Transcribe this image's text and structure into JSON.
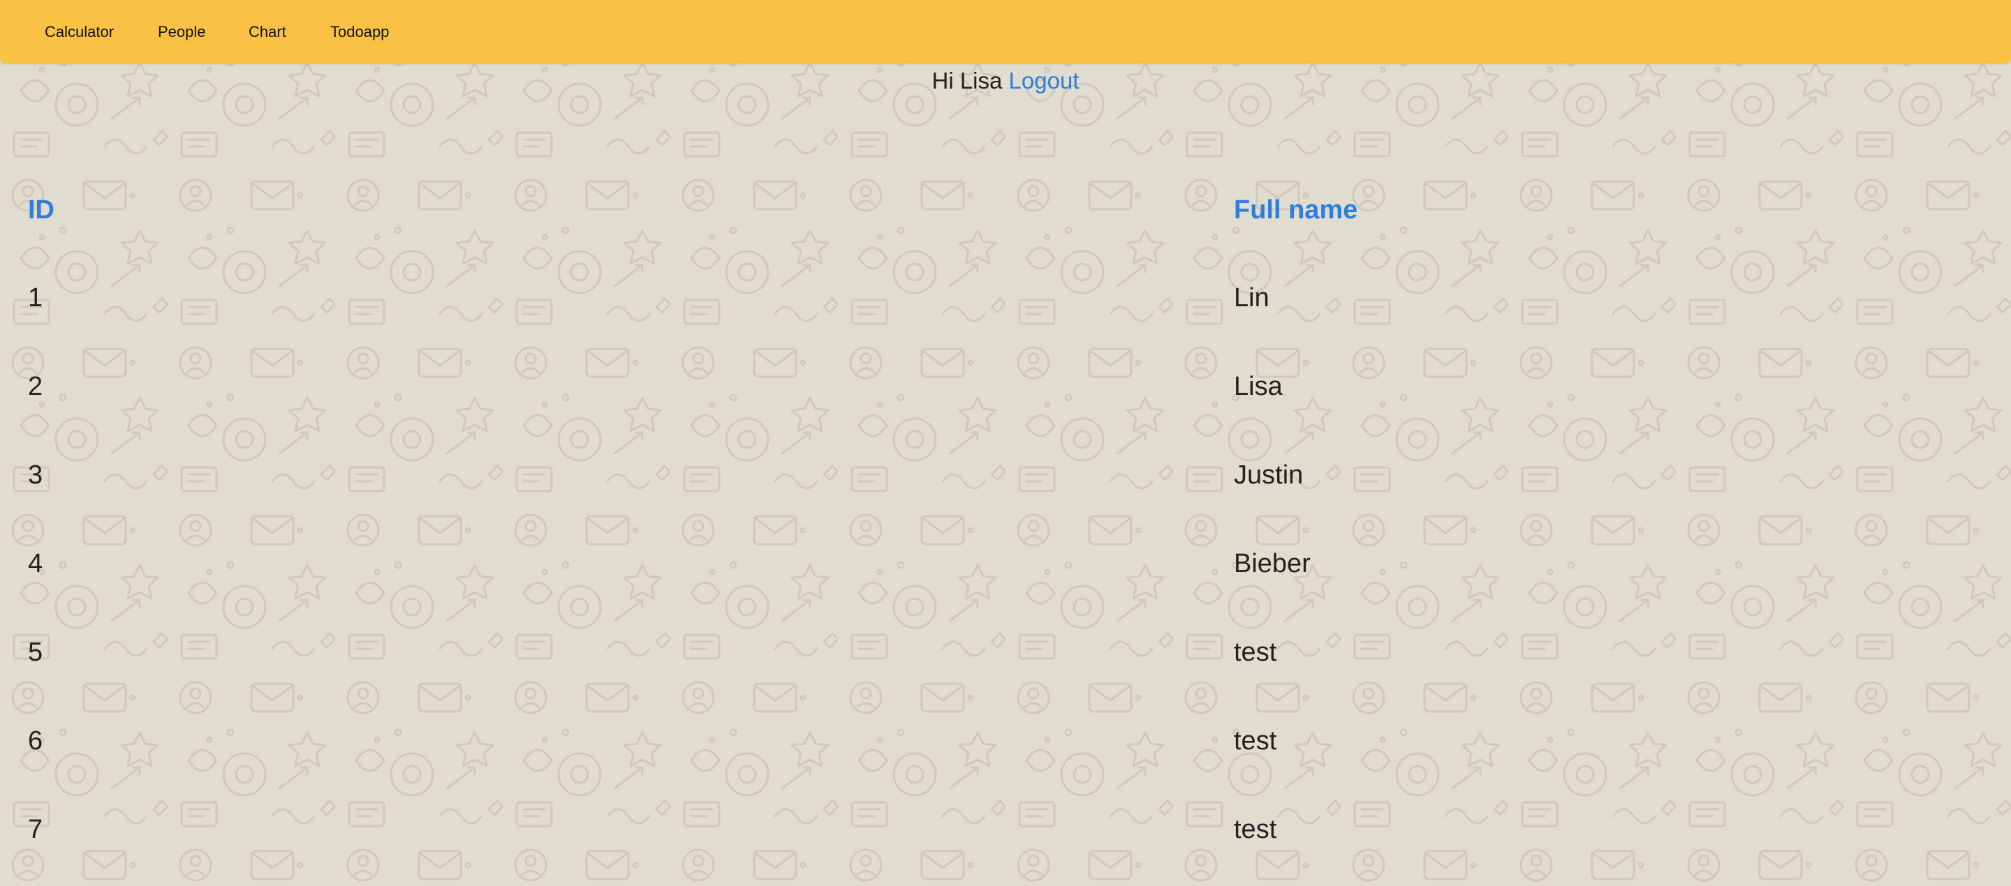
{
  "nav": {
    "items": [
      {
        "label": "Calculator"
      },
      {
        "label": "People"
      },
      {
        "label": "Chart"
      },
      {
        "label": "Todoapp"
      }
    ]
  },
  "greeting": {
    "text": "Hi Lisa",
    "logout": "Logout"
  },
  "table": {
    "headers": [
      "ID",
      "Full name"
    ],
    "rows": [
      {
        "id": "1",
        "name": "Lin"
      },
      {
        "id": "2",
        "name": "Lisa"
      },
      {
        "id": "3",
        "name": "Justin"
      },
      {
        "id": "4",
        "name": "Bieber"
      },
      {
        "id": "5",
        "name": "test"
      },
      {
        "id": "6",
        "name": "test"
      },
      {
        "id": "7",
        "name": "test"
      }
    ]
  },
  "colors": {
    "navbar": "#f9c244",
    "accent": "#2f7ddf",
    "background": "#e0dccf"
  }
}
